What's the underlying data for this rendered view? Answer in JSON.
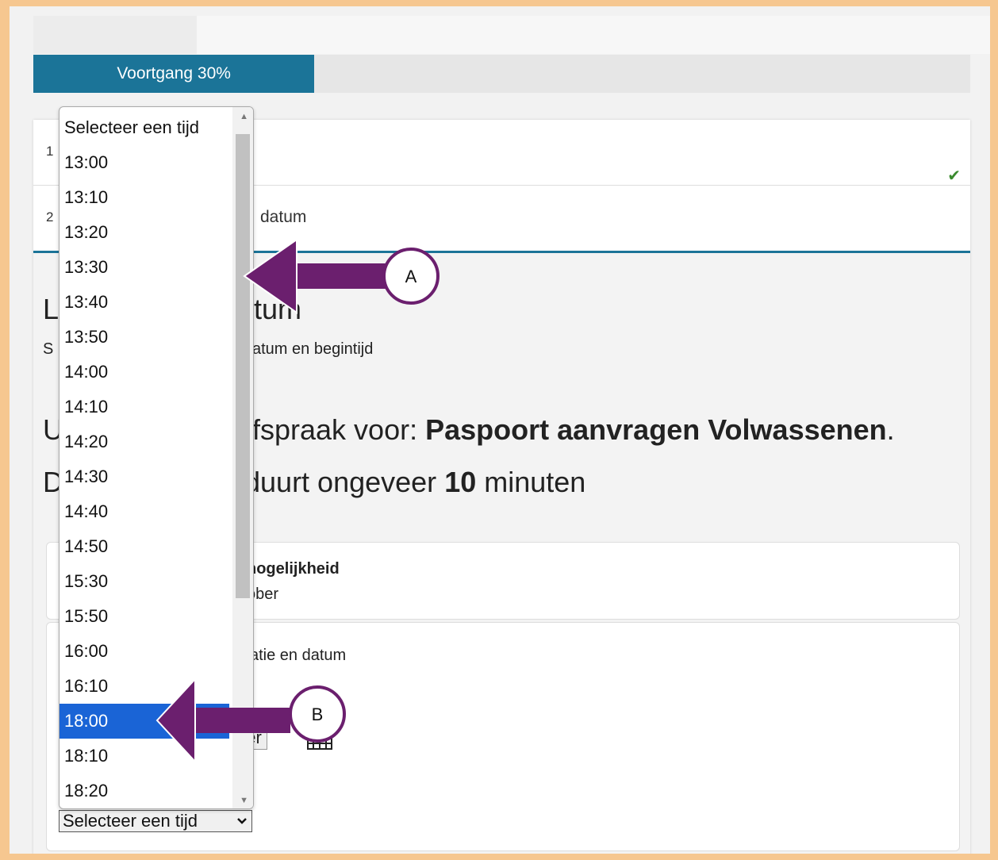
{
  "progress": {
    "label": "Voortgang 30%",
    "percent": 30
  },
  "steps": [
    {
      "number": "1",
      "label": "",
      "done": true
    },
    {
      "number": "2",
      "label": "datum"
    }
  ],
  "main": {
    "title_partial": "L",
    "title_rest": "tum",
    "subtitle_prefix": "S",
    "subtitle_rest": "atum en begintijd",
    "appointment_prefix": "U",
    "appointment_text": "fspraak voor: ",
    "appointment_service": "Paspoort aanvragen Volwassenen",
    "appointment_period": ".",
    "duration_prefix": "D",
    "duration_text": " duurt ongeveer ",
    "duration_value": "10",
    "duration_unit": " minuten"
  },
  "panel_a": {
    "bold": "nogelijkheid",
    "text": "ober"
  },
  "panel_b": {
    "text": "atie en datum",
    "date_button": "ber"
  },
  "time_select": {
    "selected_label": "Selecteer een tijd",
    "options": [
      "Selecteer een tijd",
      "13:00",
      "13:10",
      "13:20",
      "13:30",
      "13:40",
      "13:50",
      "14:00",
      "14:10",
      "14:20",
      "14:30",
      "14:40",
      "14:50",
      "15:30",
      "15:50",
      "16:00",
      "16:10",
      "18:00",
      "18:10",
      "18:20"
    ],
    "highlighted": "18:00"
  },
  "annotations": [
    {
      "label": "A"
    },
    {
      "label": "B"
    }
  ],
  "colors": {
    "accent": "#1b7498",
    "arrow": "#6b1f6e",
    "highlight": "#1a64d6",
    "frame": "#f6c790",
    "check": "#3a8a2e"
  },
  "icons": {
    "check": "check-icon",
    "calendar": "calendar-icon",
    "chevron": "chevron-down-icon"
  }
}
